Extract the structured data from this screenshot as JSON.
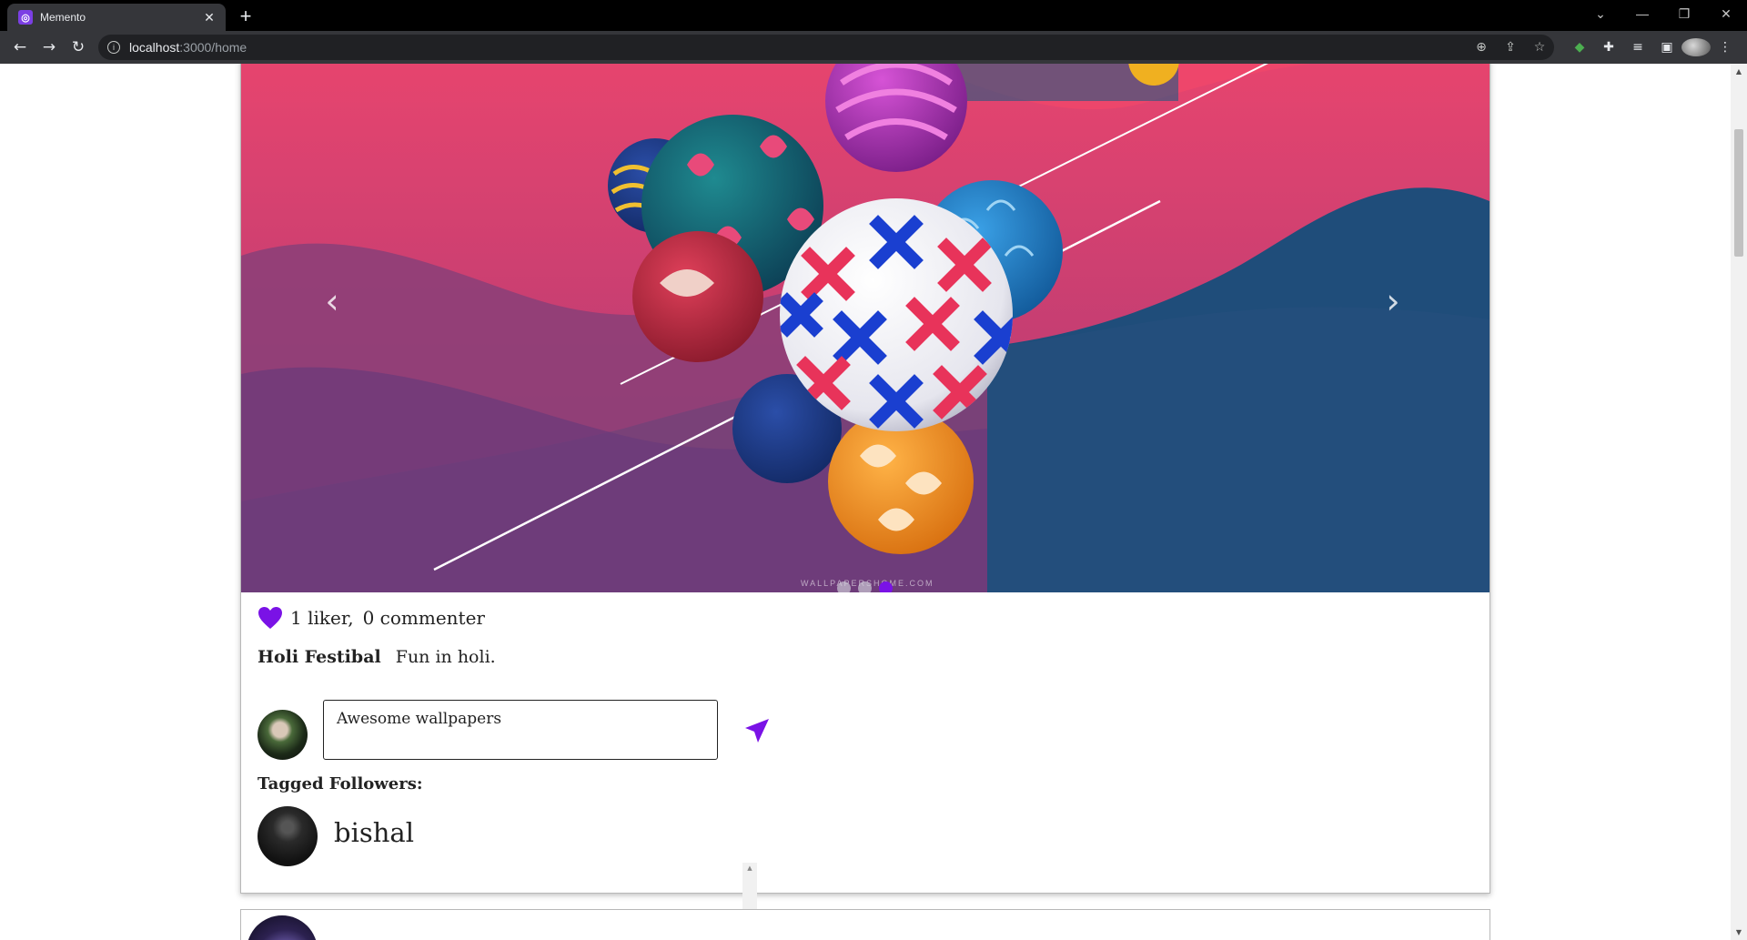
{
  "browser": {
    "tab_title": "Memento",
    "tab_close": "✕",
    "new_tab": "+",
    "url_host": "localhost",
    "url_path": ":3000/home",
    "window_controls": [
      "⌄",
      "—",
      "❐",
      "✕"
    ]
  },
  "post": {
    "carousel": {
      "prev_label": "‹",
      "next_label": "›",
      "watermark": "WALLPAPERSHOME.COM",
      "slide_count": 3,
      "active_slide": 3
    },
    "likes_text": "1 liker,",
    "comments_text": "0 commenter",
    "caption_title": "Holi Festibal",
    "caption_body": "Fun in holi.",
    "comment_value": "Awesome wallpapers",
    "tagged_heading": "Tagged Followers:",
    "tagged_followers": [
      {
        "name": "bishal"
      }
    ]
  },
  "colors": {
    "accent": "#7a12e6",
    "chrome_dark": "#35363a",
    "tab_bar": "#000000"
  },
  "icons": {
    "heart": "heart-icon",
    "send": "send-icon",
    "prev": "chevron-left-icon",
    "next": "chevron-right-icon"
  }
}
